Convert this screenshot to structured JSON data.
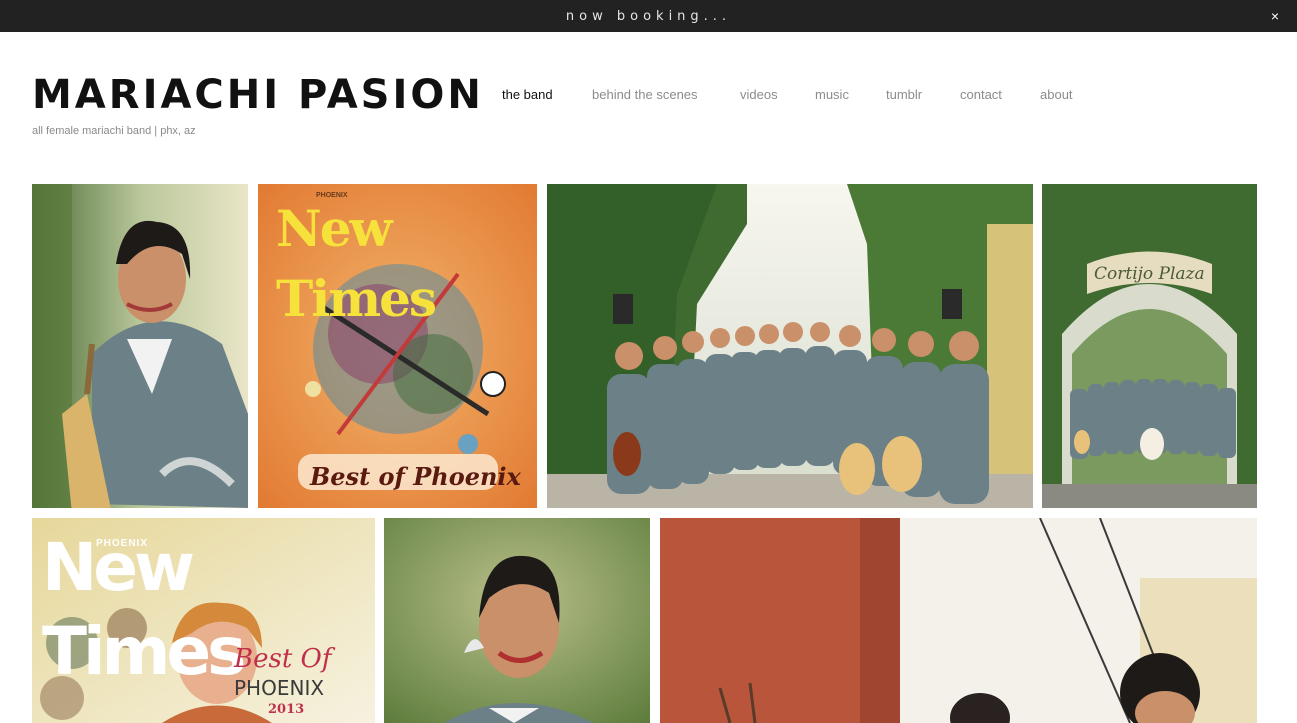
{
  "announcement": {
    "text": "now booking...",
    "close_glyph": "×"
  },
  "site": {
    "title": "MARIACHI PASION",
    "tagline": "all female mariachi band | phx, az"
  },
  "nav": {
    "items": [
      {
        "label": "the band",
        "active": true
      },
      {
        "label": "behind the scenes",
        "active": false
      },
      {
        "label": "videos",
        "active": false
      },
      {
        "label": "music",
        "active": false
      },
      {
        "label": "tumblr",
        "active": false
      },
      {
        "label": "contact",
        "active": false
      },
      {
        "label": "about",
        "active": false
      }
    ]
  },
  "gallery": {
    "items": [
      {
        "subject": "portrait of guitarist"
      },
      {
        "subject": "New Times Best of Phoenix cover",
        "cover_brand": "New Times",
        "cover_masthead": "PHOENIX",
        "cover_caption": "Best of Phoenix"
      },
      {
        "subject": "band group photo in ivy courtyard"
      },
      {
        "subject": "band under Cortijo Plaza arch",
        "sign_text": "Cortijo Plaza"
      },
      {
        "subject": "New Times Best of Phoenix 2013 cover",
        "cover_brand": "New Times",
        "cover_masthead": "PHOENIX",
        "cover_best": "Best Of",
        "cover_city": "PHOENIX",
        "cover_year": "2013"
      },
      {
        "subject": "smiling violinist portrait"
      },
      {
        "subject": "violinists performing"
      }
    ]
  },
  "colors": {
    "announce_bg": "#222222",
    "nav_active": "#111111",
    "nav_inactive": "#8c8c8c",
    "uniform": "#6b8087",
    "ivy": "#3f6b30",
    "cover_orange": "#e98a3d",
    "wall_red": "#b8553a"
  }
}
